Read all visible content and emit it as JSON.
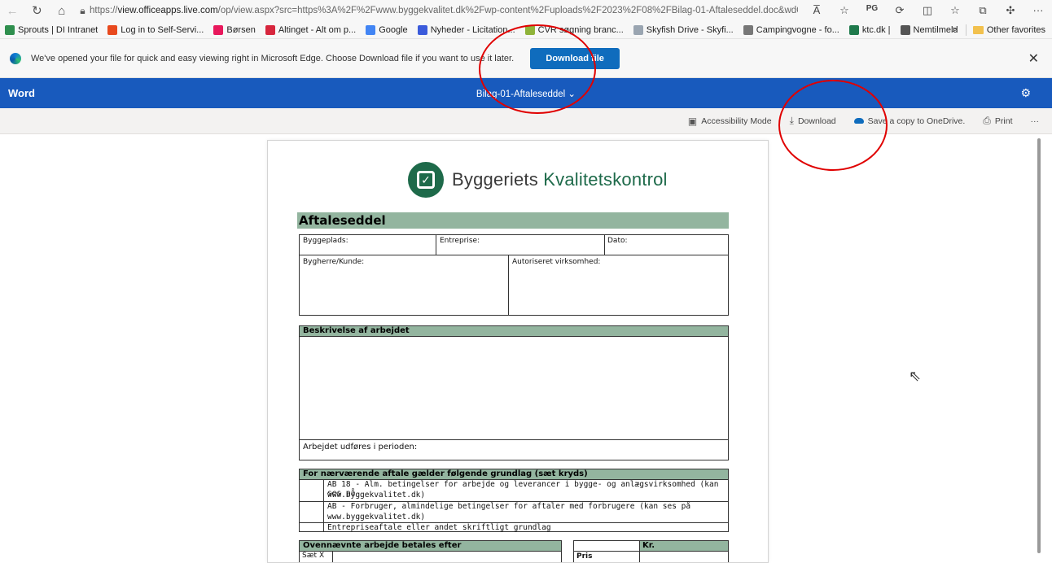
{
  "browser": {
    "url_prefix": "https://",
    "url_domain": "view.officeapps.live.com",
    "url_rest": "/op/view.aspx?src=https%3A%2F%2Fwww.byggekvalitet.dk%2Fwp-content%2Fuploads%2F2023%2F08%2FBilag-01-Aftaleseddel.doc&wdOri...",
    "read_aloud": "A̅",
    "more": "···",
    "favorites": [
      {
        "label": "Sprouts | DI Intranet",
        "color": "#2f8f4e"
      },
      {
        "label": "Log in to Self-Servi...",
        "color": "#e8491d"
      },
      {
        "label": "Børsen",
        "color": "#e8185c"
      },
      {
        "label": "Altinget - Alt om p...",
        "color": "#d7263d"
      },
      {
        "label": "Google",
        "color": "#4285f4"
      },
      {
        "label": "Nyheder - Licitation...",
        "color": "#3b5bdb"
      },
      {
        "label": "CVR søgning branc...",
        "color": "#8fb339"
      },
      {
        "label": "Skyfish Drive - Skyfi...",
        "color": "#9aa5b1"
      },
      {
        "label": "Campingvogne - fo...",
        "color": "#777777"
      },
      {
        "label": "ktc.dk |",
        "color": "#1f7a4c"
      },
      {
        "label": "Nemtilmeld",
        "color": "#555555"
      }
    ],
    "other_favorites": "Other favorites",
    "chevron": ">"
  },
  "infobar": {
    "message": "We've opened your file for quick and easy viewing right in Microsoft Edge. Choose Download file if you want to use it later.",
    "download_label": "Download file",
    "close": "✕"
  },
  "word": {
    "brand": "Word",
    "doc_title": "Bilag-01-Aftaleseddel ⌄",
    "commands": {
      "accessibility": "Accessibility Mode",
      "download": "Download",
      "save_copy": "Save a copy to OneDrive.",
      "print": "Print",
      "more": "···"
    }
  },
  "document": {
    "logo_text_1": "Byggeriets ",
    "logo_text_2": "Kvalitetskontrol",
    "title": "Aftaleseddel",
    "fields": {
      "byggeplads": "Byggeplads:",
      "entreprise": "Entreprise:",
      "dato": "Dato:",
      "bygherre": "Bygherre/Kunde:",
      "autoriseret": "Autoriseret virksomhed:"
    },
    "beskrivelse_head": "Beskrivelse af arbejdet",
    "periode": "Arbejdet udføres i perioden:",
    "grundlag_head": "For nærværende aftale gælder følgende grundlag (sæt kryds)",
    "grundlag_rows": [
      {
        "line1": "AB 18 - Alm. betingelser for arbejde og leverancer i bygge- og anlægsvirksomhed (kan ses på",
        "line2": "www.byggekvalitet.dk)"
      },
      {
        "line1": "AB - Forbruger, almindelige betingelser for aftaler med forbrugere (kan ses på",
        "line2": "www.byggekvalitet.dk)"
      },
      {
        "line1": "Entrepriseaftale eller andet skriftligt grundlag",
        "line2": ""
      }
    ],
    "betales_head": "Ovennævnte arbejde betales efter",
    "kr": "Kr.",
    "saet_x": "Sæt X",
    "pris": "Pris"
  }
}
